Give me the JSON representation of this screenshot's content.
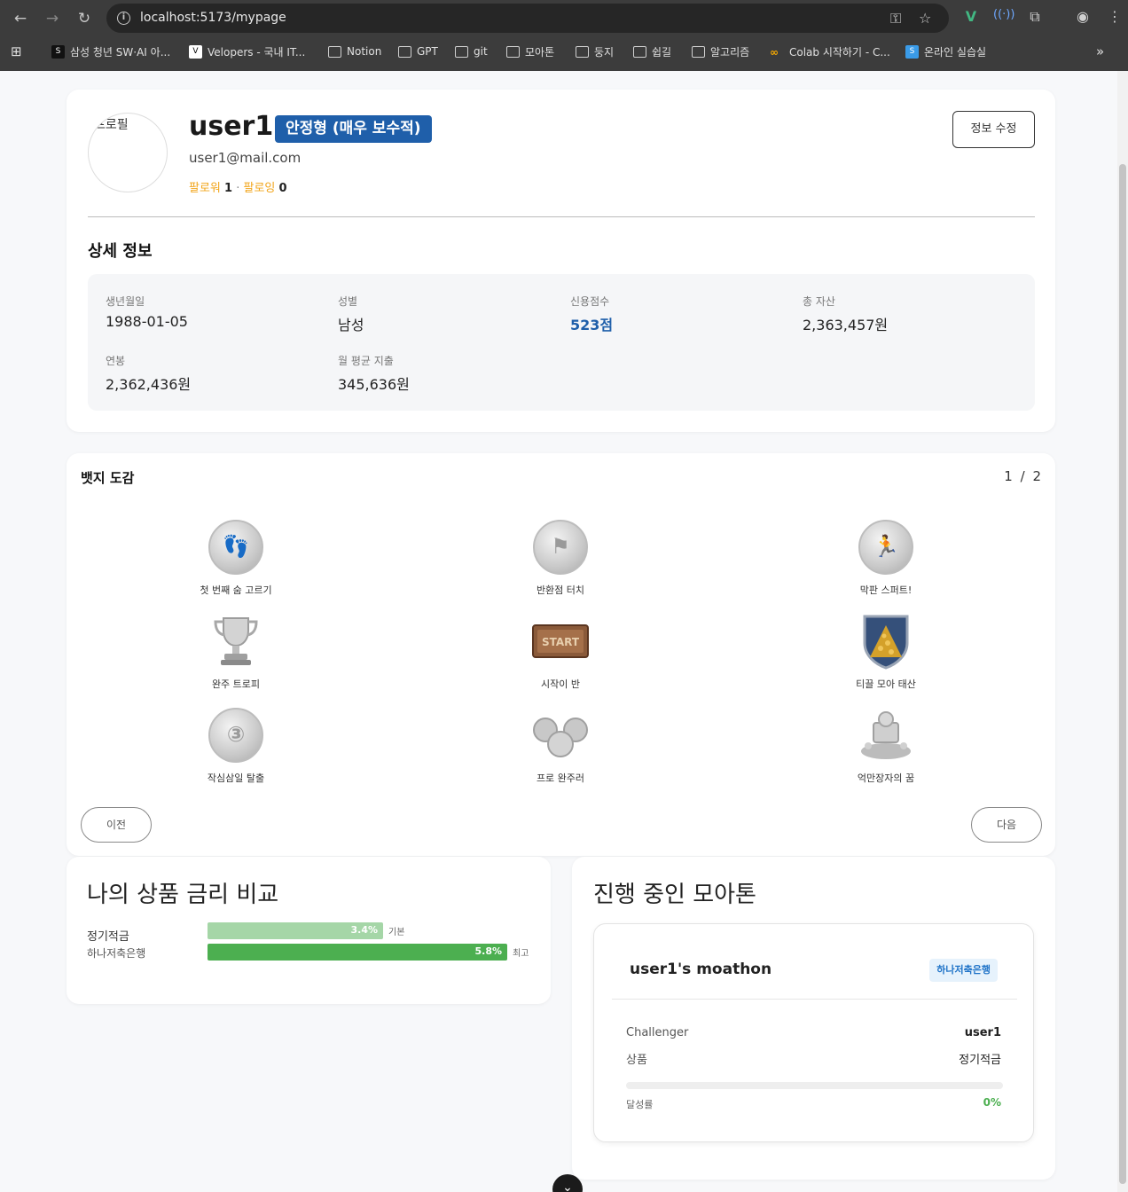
{
  "browser": {
    "url": "localhost:5173/mypage",
    "bookmarks": [
      {
        "label": "삼성 청년 SW·AI 아...",
        "icon": "ssafy-favicon"
      },
      {
        "label": "Velopers - 국내 IT...",
        "icon": "velopers-favicon"
      },
      {
        "label": "Notion",
        "icon": "folder-icon"
      },
      {
        "label": "GPT",
        "icon": "folder-icon"
      },
      {
        "label": "git",
        "icon": "folder-icon"
      },
      {
        "label": "모아톤",
        "icon": "folder-icon"
      },
      {
        "label": "둥지",
        "icon": "folder-icon"
      },
      {
        "label": "쉽길",
        "icon": "folder-icon"
      },
      {
        "label": "알고리즘",
        "icon": "folder-icon"
      },
      {
        "label": "Colab 시작하기 - C...",
        "icon": "colab-favicon"
      },
      {
        "label": "온라인 실습실",
        "icon": "ssafy-favicon"
      }
    ]
  },
  "profile": {
    "avatar_alt": "프로필",
    "username": "user1",
    "risk_type": "안정형 (매우 보수적)",
    "email": "user1@mail.com",
    "follower_label": "팔로워",
    "follower_count": "1",
    "separator": "·",
    "following_label": "팔로잉",
    "following_count": "0",
    "edit_button": "정보 수정"
  },
  "details": {
    "title": "상세 정보",
    "items": [
      {
        "label": "생년월일",
        "value": "1988-01-05"
      },
      {
        "label": "성별",
        "value": "남성"
      },
      {
        "label": "신용점수",
        "value": "523점"
      },
      {
        "label": "총 자산",
        "value": "2,363,457원"
      },
      {
        "label": "연봉",
        "value": "2,362,436원"
      },
      {
        "label": "월 평균 지출",
        "value": "345,636원"
      }
    ]
  },
  "badges": {
    "title": "뱃지 도감",
    "current_page": "1",
    "page_separator": "/",
    "total_pages": "2",
    "items": [
      {
        "name": "첫 번째 숨 고르기",
        "icon": "footprint-medal-icon"
      },
      {
        "name": "반환점 터치",
        "icon": "flag-medal-icon"
      },
      {
        "name": "막판 스퍼트!",
        "icon": "runner-medal-icon"
      },
      {
        "name": "완주 트로피",
        "icon": "trophy-icon"
      },
      {
        "name": "시작이 반",
        "icon": "start-plaque-icon"
      },
      {
        "name": "티끌 모아 태산",
        "icon": "coin-mountain-shield-icon"
      },
      {
        "name": "작심삼일 탈출",
        "icon": "calendar-3-medal-icon"
      },
      {
        "name": "프로 완주러",
        "icon": "triple-medal-icon"
      },
      {
        "name": "억만장자의 꿈",
        "icon": "treasure-pile-icon"
      }
    ],
    "prev_button": "이전",
    "next_button": "다음"
  },
  "rate_compare": {
    "title": "나의 상품 금리 비교",
    "product": "정기적금",
    "bank": "하나저축은행",
    "bars": [
      {
        "value_label": "3.4%",
        "tag": "기본",
        "value": 3.4,
        "color": "#a5d6a7"
      },
      {
        "value_label": "5.8%",
        "tag": "최고",
        "value": 5.8,
        "color": "#4caf50"
      }
    ]
  },
  "moathon": {
    "title": "진행 중인 모아톤",
    "name": "user1's moathon",
    "bank": "하나저축은행",
    "challenger_label": "Challenger",
    "challenger_value": "user1",
    "product_label": "상품",
    "product_value": "정기적금",
    "progress_label": "달성률",
    "progress_value": "0%",
    "progress": 0
  }
}
